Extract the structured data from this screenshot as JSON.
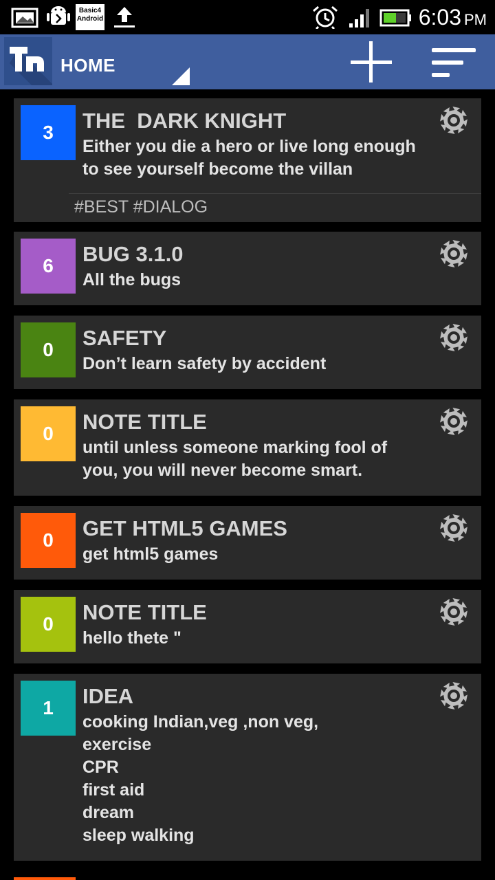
{
  "status_bar": {
    "time": "6:03",
    "ampm": "PM",
    "notification_icons": [
      "image-icon",
      "android-debug-icon",
      "basic4android-icon",
      "upload-icon"
    ],
    "system_icons": [
      "alarm-icon",
      "signal-icon",
      "battery-icon"
    ],
    "basic4android_text": "Basic4 Android"
  },
  "action_bar": {
    "logo_text": "Tn",
    "title": "HOME",
    "add_icon": "plus-icon",
    "sort_icon": "sort-icon"
  },
  "notes": [
    {
      "count": "3",
      "title": "THE  DARK KNIGHT",
      "body": "Either you die a hero or live long enough\nto see yourself become the villan",
      "tags": "#BEST #DIALOG",
      "color": "#0a63ff"
    },
    {
      "count": "6",
      "title": "BUG 3.1.0",
      "body": "All the bugs",
      "color": "#a55cc8"
    },
    {
      "count": "0",
      "title": "SAFETY",
      "body": "Don’t learn safety by accident",
      "color": "#4a8412"
    },
    {
      "count": "0",
      "title": "NOTE TITLE",
      "body": "until unless someone marking fool of\nyou, you will never become smart.",
      "color": "#ffba33"
    },
    {
      "count": "0",
      "title": "GET HTML5 GAMES",
      "body": "get html5 games",
      "color": "#ff5a0a"
    },
    {
      "count": "0",
      "title": "NOTE TITLE",
      "body": "hello thete \"",
      "color": "#a5c20e"
    },
    {
      "count": "1",
      "title": "IDEA",
      "body": "cooking Indian,veg ,non veg,\nexercise\nCPR\nfirst aid\ndream\nsleep walking",
      "color": "#0ea8a4"
    }
  ]
}
